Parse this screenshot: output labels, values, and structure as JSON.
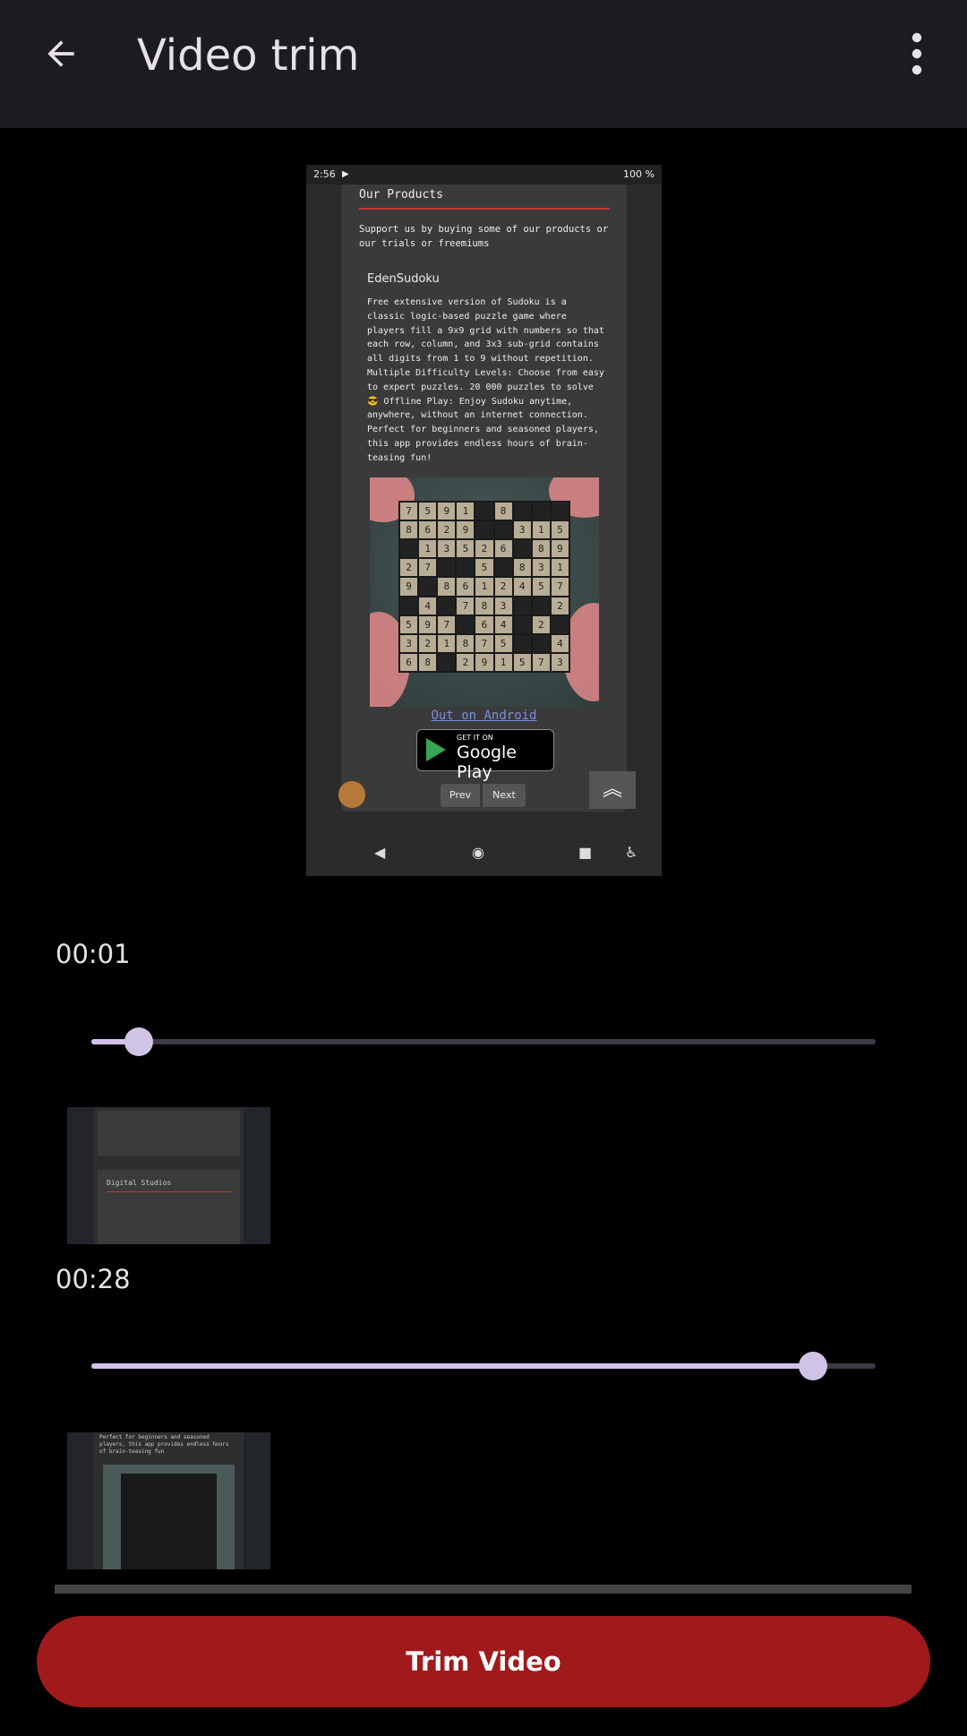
{
  "appbar": {
    "title": "Video trim",
    "back_icon": "arrow-back-icon",
    "menu_icon": "more-vert-icon"
  },
  "preview": {
    "status_time": "2:56",
    "status_battery": "100 %",
    "heading": "Our Products",
    "support_text": "Support us by buying some of our products or our trials or freemiums",
    "product_name": "EdenSudoku",
    "product_description": "Free extensive version of Sudoku is a classic logic-based puzzle game where players fill a 9x9 grid with numbers so that each row, column, and 3x3 sub-grid contains all digits from 1 to 9 without repetition. Multiple Difficulty Levels: Choose from easy to expert puzzles. 20 000 puzzles to solve 😎 Offline Play: Enjoy Sudoku anytime, anywhere, without an internet connection. Perfect for beginners and seasoned players, this app provides endless hours of brain-teasing fun!",
    "link_text": "Out on Android",
    "play_small": "GET IT ON",
    "play_big": "Google Play",
    "prev_label": "Prev",
    "next_label": "Next",
    "grid": [
      "7",
      "5",
      "9",
      "1",
      "",
      "8",
      "",
      "",
      "",
      "8",
      "6",
      "2",
      "9",
      "",
      "",
      "3",
      "1",
      "5",
      "",
      "1",
      "3",
      "5",
      "2",
      "6",
      "",
      "8",
      "9",
      "2",
      "7",
      "",
      "",
      "5",
      "",
      "8",
      "3",
      "1",
      "9",
      "",
      "8",
      "6",
      "1",
      "2",
      "4",
      "5",
      "7",
      "",
      "4",
      "",
      "7",
      "8",
      "3",
      "",
      "",
      "2",
      "5",
      "9",
      "7",
      "",
      "6",
      "4",
      "",
      "2",
      "",
      "3",
      "2",
      "1",
      "8",
      "7",
      "5",
      "",
      "",
      "4",
      "6",
      "8",
      "",
      "2",
      "9",
      "1",
      "5",
      "7",
      "3"
    ]
  },
  "trim": {
    "start_time": "00:01",
    "start_fraction": 0.06,
    "end_time": "00:28",
    "end_fraction": 0.92
  },
  "frames": {
    "start_title": "Digital Studios",
    "end_caption": "Perfect for beginners and seasoned players, this app provides endless hours of brain-teasing fun"
  },
  "actions": {
    "trim_label": "Trim Video"
  },
  "colors": {
    "accent": "#a0191b",
    "slider": "#cfc3e6",
    "appbar": "#1c1b22"
  }
}
